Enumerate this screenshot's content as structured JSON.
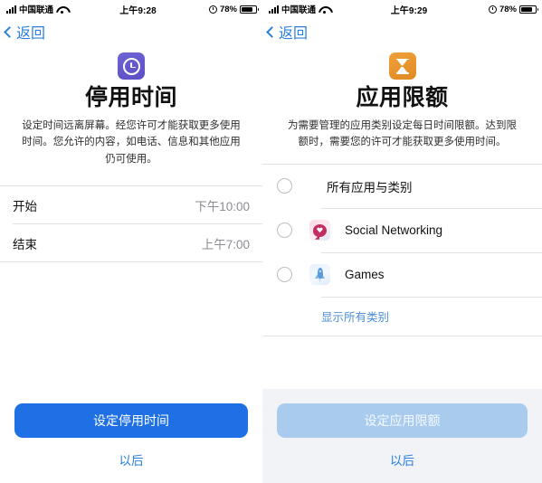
{
  "screens": [
    {
      "id": "downtime",
      "statusbar": {
        "carrier": "中国联通",
        "time": "上午9:28",
        "battery_pct": "78%",
        "signal_icon": "cellular-signal-icon",
        "wifi_icon": "wifi-icon",
        "alarm_icon": "alarm-clock-icon",
        "battery_icon": "battery-icon"
      },
      "nav": {
        "back_label": "返回",
        "back_icon": "chevron-left-icon"
      },
      "hero": {
        "icon_name": "downtime-clock-icon",
        "icon_color": "#5f52c9",
        "title": "停用时间",
        "subtitle": "设定时间远离屏幕。经您许可才能获取更多使用时间。您允许的内容，如电话、信息和其他应用仍可使用。"
      },
      "rows": [
        {
          "label": "开始",
          "value": "下午10:00"
        },
        {
          "label": "结束",
          "value": "上午7:00"
        }
      ],
      "footer": {
        "cta_label": "设定停用时间",
        "cta_state": "enabled",
        "cta_color": "#1f6fe5",
        "later_label": "以后",
        "later_color": "#2b7fe0"
      }
    },
    {
      "id": "app-limits",
      "statusbar": {
        "carrier": "中国联通",
        "time": "上午9:29",
        "battery_pct": "78%",
        "signal_icon": "cellular-signal-icon",
        "wifi_icon": "wifi-icon",
        "alarm_icon": "alarm-clock-icon",
        "battery_icon": "battery-icon"
      },
      "nav": {
        "back_label": "返回",
        "back_icon": "chevron-left-icon"
      },
      "hero": {
        "icon_name": "hourglass-icon",
        "icon_color": "#e8942c",
        "title": "应用限额",
        "subtitle": "为需要管理的应用类别设定每日时间限额。达到限额时，需要您的许可才能获取更多使用时间。"
      },
      "options": [
        {
          "label": "所有应用与类别",
          "icon": "none",
          "selected": false
        },
        {
          "label": "Social Networking",
          "icon": "social-networking-icon",
          "selected": false
        },
        {
          "label": "Games",
          "icon": "games-rocket-icon",
          "selected": false
        }
      ],
      "show_all_label": "显示所有类别",
      "footer": {
        "cta_label": "设定应用限额",
        "cta_state": "disabled",
        "cta_color": "#a9cbee",
        "later_label": "以后",
        "later_color": "#2b7fe0"
      }
    }
  ]
}
